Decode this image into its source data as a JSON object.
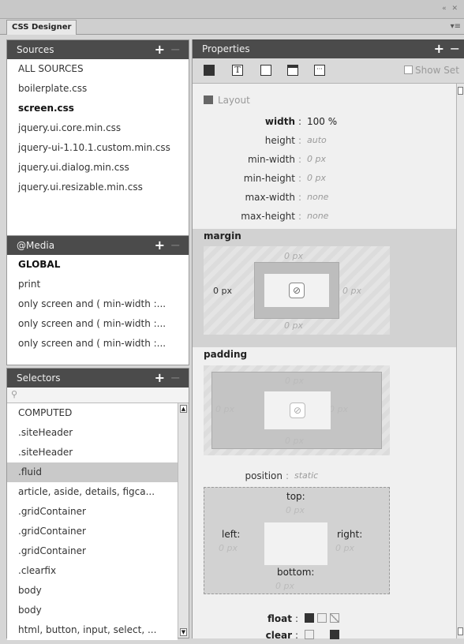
{
  "panel_tab": "CSS Designer",
  "sources": {
    "title": "Sources",
    "items": [
      "ALL SOURCES",
      "boilerplate.css",
      "screen.css",
      "jquery.ui.core.min.css",
      "jquery-ui-1.10.1.custom.min.css",
      "jquery.ui.dialog.min.css",
      "jquery.ui.resizable.min.css"
    ],
    "selected": "screen.css"
  },
  "media": {
    "title": "@Media",
    "items": [
      "GLOBAL",
      "print",
      "only screen and ( min-width :...",
      "only screen and ( min-width :...",
      "only screen and ( min-width :..."
    ]
  },
  "selectors": {
    "title": "Selectors",
    "search_placeholder": "",
    "items": [
      "COMPUTED",
      ".siteHeader",
      ".siteHeader",
      ".fluid",
      "article, aside, details, figca...",
      ".gridContainer",
      ".gridContainer",
      ".gridContainer",
      ".clearfix",
      "body",
      "body",
      "html, button, input, select, ..."
    ],
    "selected": ".fluid"
  },
  "properties": {
    "title": "Properties",
    "show_set_label": "Show Set",
    "layout_label": "Layout",
    "fields": [
      {
        "name": "width",
        "value": "100 %",
        "set": true
      },
      {
        "name": "height",
        "value": "auto",
        "set": false
      },
      {
        "name": "min-width",
        "value": "0 px",
        "set": false
      },
      {
        "name": "min-height",
        "value": "0 px",
        "set": false
      },
      {
        "name": "max-width",
        "value": "none",
        "set": false
      },
      {
        "name": "max-height",
        "value": "none",
        "set": false
      }
    ],
    "margin": {
      "label": "margin",
      "top": "0 px",
      "right": "0 px",
      "bottom": "0 px",
      "left": "0 px"
    },
    "padding": {
      "label": "padding",
      "top": "0 px",
      "right": "0 px",
      "bottom": "0 px",
      "left": "0 px"
    },
    "position": {
      "label": "position",
      "value": "static"
    },
    "offsets": {
      "top_label": "top:",
      "top": "0 px",
      "left_label": "left:",
      "left": "0 px",
      "right_label": "right:",
      "right": "0 px",
      "bottom_label": "bottom:",
      "bottom": "0 px"
    },
    "float_label": "float",
    "clear_label": "clear"
  }
}
